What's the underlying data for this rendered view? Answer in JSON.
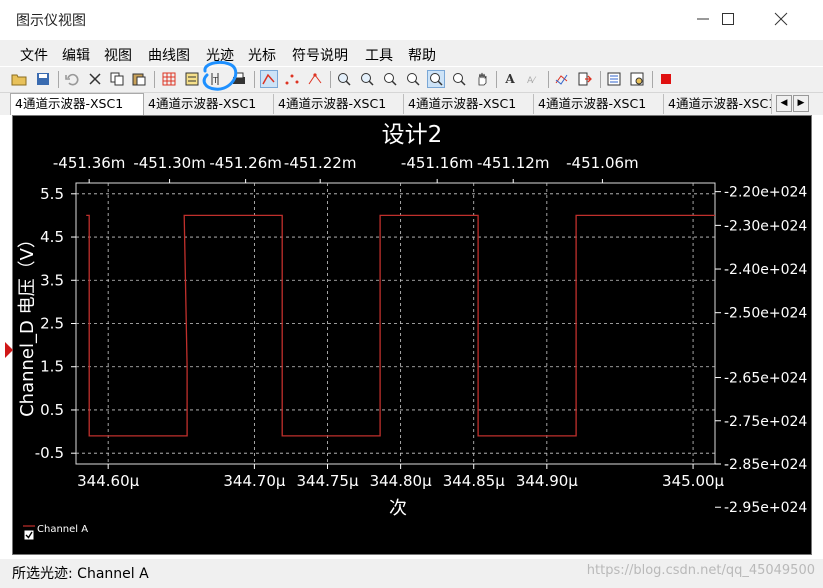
{
  "window": {
    "title": "图示仪视图"
  },
  "menu": [
    "文件",
    "编辑",
    "视图",
    "曲线图",
    "光迹",
    "光标",
    "符号说明",
    "工具",
    "帮助"
  ],
  "tabs": [
    "4通道示波器-XSC1",
    "4通道示波器-XSC1",
    "4通道示波器-XSC1",
    "4通道示波器-XSC1",
    "4通道示波器-XSC1",
    "4通道示波器-XSC1"
  ],
  "colors": {
    "trace": "#c0302c",
    "plot_bg": "#000000",
    "grid": "#cccccc",
    "highlight_circle": "#1e90ff"
  },
  "chart_data": {
    "type": "line",
    "title": "设计2",
    "xlabel": "次",
    "ylabel": "Channel_D 电压（V）",
    "xlim": [
      344.578,
      345.015
    ],
    "ylim": [
      -0.75,
      5.75
    ],
    "x_ticks": [
      "344.60µ",
      "344.70µ",
      "344.75µ",
      "344.80µ",
      "344.85µ",
      "344.90µ",
      "345.00µ"
    ],
    "x_tick_values": [
      344.6,
      344.7,
      344.75,
      344.8,
      344.85,
      344.9,
      345.0
    ],
    "y_ticks": [
      "5.5",
      "4.5",
      "3.5",
      "2.5",
      "1.5",
      "0.5",
      "-0.5"
    ],
    "y_tick_values": [
      5.5,
      4.5,
      3.5,
      2.5,
      1.5,
      0.5,
      -0.5
    ],
    "top_x_ticks": [
      "-451.36m",
      "-451.30m",
      "-451.26m",
      "-451.22m",
      "-451.16m",
      "-451.12m",
      "-451.06m"
    ],
    "top_x_tick_values": [
      344.587,
      344.642,
      344.694,
      344.745,
      344.825,
      344.877,
      344.938
    ],
    "right_y_ticks": [
      "-2.20e+024",
      "-2.30e+024",
      "-2.40e+024",
      "-2.50e+024",
      "-2.65e+024",
      "-2.75e+024",
      "-2.85e+024",
      "-2.95e+024"
    ],
    "right_y_tick_values": [
      5.55,
      4.77,
      3.76,
      2.75,
      1.25,
      0.25,
      -0.75,
      -1.75
    ],
    "grid": true,
    "legend": "bottom-left",
    "series": [
      {
        "name": "Channel A",
        "x": [
          344.585,
          344.587,
          344.587,
          344.654,
          344.654,
          344.652,
          344.719,
          344.719,
          344.786,
          344.786,
          344.853,
          344.853,
          344.92,
          344.92,
          344.987,
          344.987,
          345.015
        ],
        "y": [
          5.0,
          5.0,
          -0.1,
          -0.1,
          1.5,
          5.0,
          5.0,
          -0.1,
          -0.1,
          5.0,
          5.0,
          -0.1,
          -0.1,
          5.0,
          5.0,
          5.0,
          5.0
        ]
      }
    ]
  },
  "status": {
    "text": "所选光迹:  Channel A",
    "watermark": "https://blog.csdn.net/qq_45049500"
  }
}
